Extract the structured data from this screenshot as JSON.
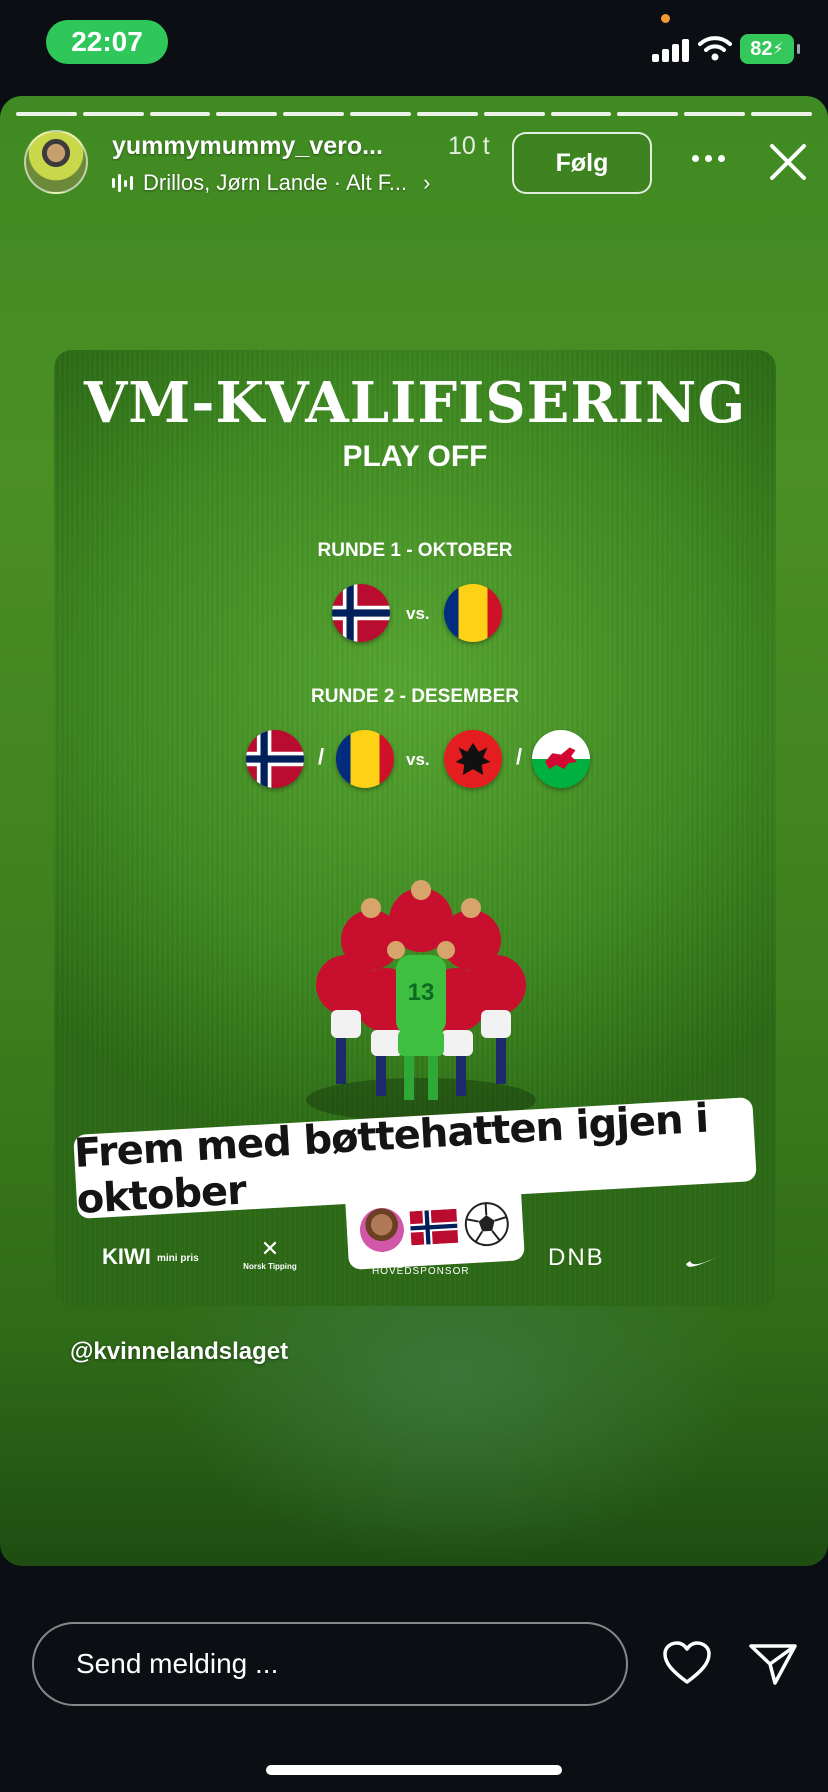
{
  "status_bar": {
    "time": "22:07",
    "battery": "82",
    "icons": [
      "signal-icon",
      "wifi-icon",
      "battery-charging-icon"
    ]
  },
  "story": {
    "segments": 12,
    "username": "yummymummy_vero...",
    "age": "10 t",
    "music": "Drillos, Jørn Lande · Alt F...",
    "follow_label": "Følg",
    "more_icon": "more-icon",
    "close_icon": "close-icon"
  },
  "poster": {
    "title": "VM-KVALIFISERING",
    "subtitle": "PLAY OFF",
    "round1": {
      "label": "RUNDE 1 - OKTOBER",
      "vs": "vs.",
      "home_flag": "norway-flag-icon",
      "away_flag": "romania-flag-icon"
    },
    "round2": {
      "label": "RUNDE 2 - DESEMBER",
      "vs": "vs.",
      "slash": "/",
      "flags": [
        "norway-flag-icon",
        "romania-flag-icon",
        "albania-flag-icon",
        "wales-flag-icon"
      ]
    },
    "sponsors": {
      "kiwi": "KIWI",
      "kiwi_small": "mini pris",
      "norsk_tipping": "Norsk Tipping",
      "hovedsponsor": "HOVEDSPONSOR",
      "dnb": "DNB",
      "nike": "nike-swoosh-icon"
    }
  },
  "sticker": {
    "text": "Frem med bøttehatten igjen i oktober",
    "emojis": [
      "person-raising-hand-emoji",
      "norway-flag-emoji",
      "soccer-ball-emoji"
    ]
  },
  "mention": "@kvinnelandslaget",
  "bottom": {
    "message_placeholder": "Send melding ...",
    "like_icon": "heart-icon",
    "share_icon": "send-icon"
  },
  "colors": {
    "status_green": "#30c75a",
    "background": "#0b0f14",
    "norway_red": "#ba0c2f",
    "norway_blue": "#00205b"
  }
}
